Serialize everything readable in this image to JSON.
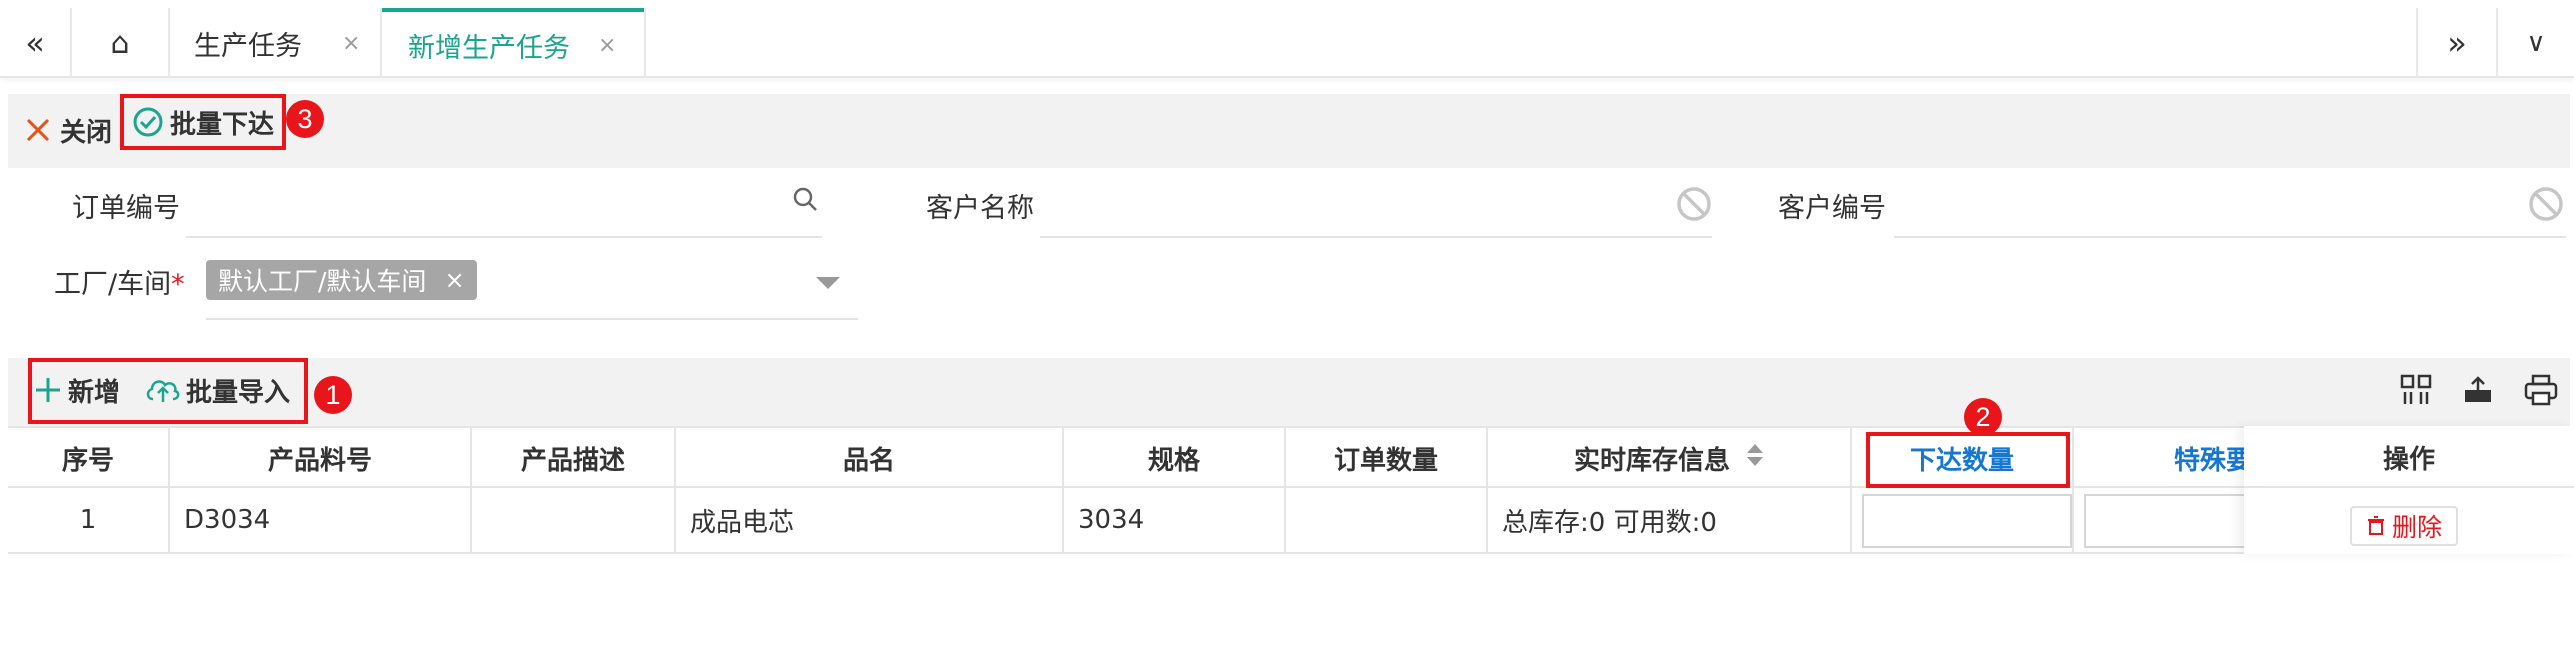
{
  "tabs": {
    "nav_left": "«",
    "home": "⌂",
    "items": [
      {
        "label": "生产任务",
        "close": "×"
      },
      {
        "label": "新增生产任务",
        "close": "×"
      }
    ],
    "nav_right": "»",
    "dropdown": "∨"
  },
  "toolbar": {
    "close_label": "关闭",
    "batch_issue_label": "批量下达",
    "badge": "3"
  },
  "form": {
    "order_no_label": "订单编号",
    "order_no_value": "",
    "customer_name_label": "客户名称",
    "customer_name_value": "",
    "customer_no_label": "客户编号",
    "customer_no_value": "",
    "factory_label": "工厂/车间",
    "required_mark": "*",
    "factory_chip": "默认工厂/默认车间",
    "chip_close": "×"
  },
  "grid_toolbar": {
    "add_label": "新增",
    "batch_import_label": "批量导入",
    "badge": "1"
  },
  "table": {
    "headers": [
      "序号",
      "产品料号",
      "产品描述",
      "品名",
      "规格",
      "订单数量",
      "实时库存信息",
      "下达数量",
      "特殊要",
      "操作"
    ],
    "badge": "2",
    "rows": [
      {
        "index": "1",
        "part_no": "D3034",
        "desc": "",
        "name": "成品电芯",
        "spec": "3034",
        "order_qty": "",
        "stock": "总库存:0 可用数:0",
        "issue_qty": "",
        "special": "",
        "delete_label": "删除"
      }
    ]
  },
  "colors": {
    "accent": "#1aa58f",
    "blue_header": "#1677d2",
    "highlight": "#e8151b"
  }
}
